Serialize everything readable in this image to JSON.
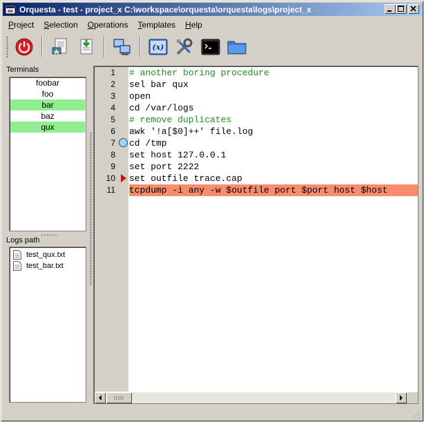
{
  "window": {
    "title": "Orquesta - test - project_x C:\\workspace\\orquesta\\orquesta\\logs\\project_x"
  },
  "menu": [
    {
      "label": "Project",
      "mnemonic": "P",
      "rest": "roject"
    },
    {
      "label": "Selection",
      "mnemonic": "S",
      "rest": "election"
    },
    {
      "label": "Operations",
      "mnemonic": "O",
      "rest": "perations"
    },
    {
      "label": "Templates",
      "mnemonic": "T",
      "rest": "emplates"
    },
    {
      "label": "Help",
      "mnemonic": "H",
      "rest": "elp"
    }
  ],
  "toolbar": {
    "icons": [
      "power-icon",
      "open-project-icon",
      "save-project-icon",
      "network-computers-icon",
      "variables-icon",
      "tools-icon",
      "console-icon",
      "folder-icon"
    ]
  },
  "terminals": {
    "label": "Terminals",
    "items": [
      {
        "name": "foobar",
        "highlighted": false
      },
      {
        "name": "foo",
        "highlighted": false
      },
      {
        "name": "bar",
        "highlighted": true
      },
      {
        "name": "baz",
        "highlighted": false
      },
      {
        "name": "qux",
        "highlighted": true
      }
    ]
  },
  "logs": {
    "label": "Logs path",
    "files": [
      "test_qux.txt",
      "test_bar.txt"
    ]
  },
  "editor": {
    "lines": [
      {
        "num": "1",
        "text": "# another boring procedure",
        "type": "comment"
      },
      {
        "num": "2",
        "text": "sel bar qux",
        "type": "code"
      },
      {
        "num": "3",
        "text": "open",
        "type": "code"
      },
      {
        "num": "4",
        "text": "cd /var/logs",
        "type": "code"
      },
      {
        "num": "5",
        "text": "# remove duplicates",
        "type": "comment"
      },
      {
        "num": "6",
        "text": "awk '!a[$0]++' file.log",
        "type": "code"
      },
      {
        "num": "7",
        "text": "cd /tmp",
        "type": "code",
        "marker": "breakpoint"
      },
      {
        "num": "8",
        "text": "set host 127.0.0.1",
        "type": "code"
      },
      {
        "num": "9",
        "text": "set port 2222",
        "type": "code"
      },
      {
        "num": "10",
        "text": "set outfile trace.cap",
        "type": "code",
        "marker": "arrow"
      },
      {
        "num": "11",
        "text": "tcpdump -i any -w $outfile port $port host $host",
        "type": "code",
        "current": true
      }
    ],
    "colors": {
      "comment": "#228b22",
      "current_line": "#fa8c6e",
      "highlight": "#90ee90",
      "breakpoint": "#9fd4f0",
      "arrow": "#d01010"
    }
  }
}
